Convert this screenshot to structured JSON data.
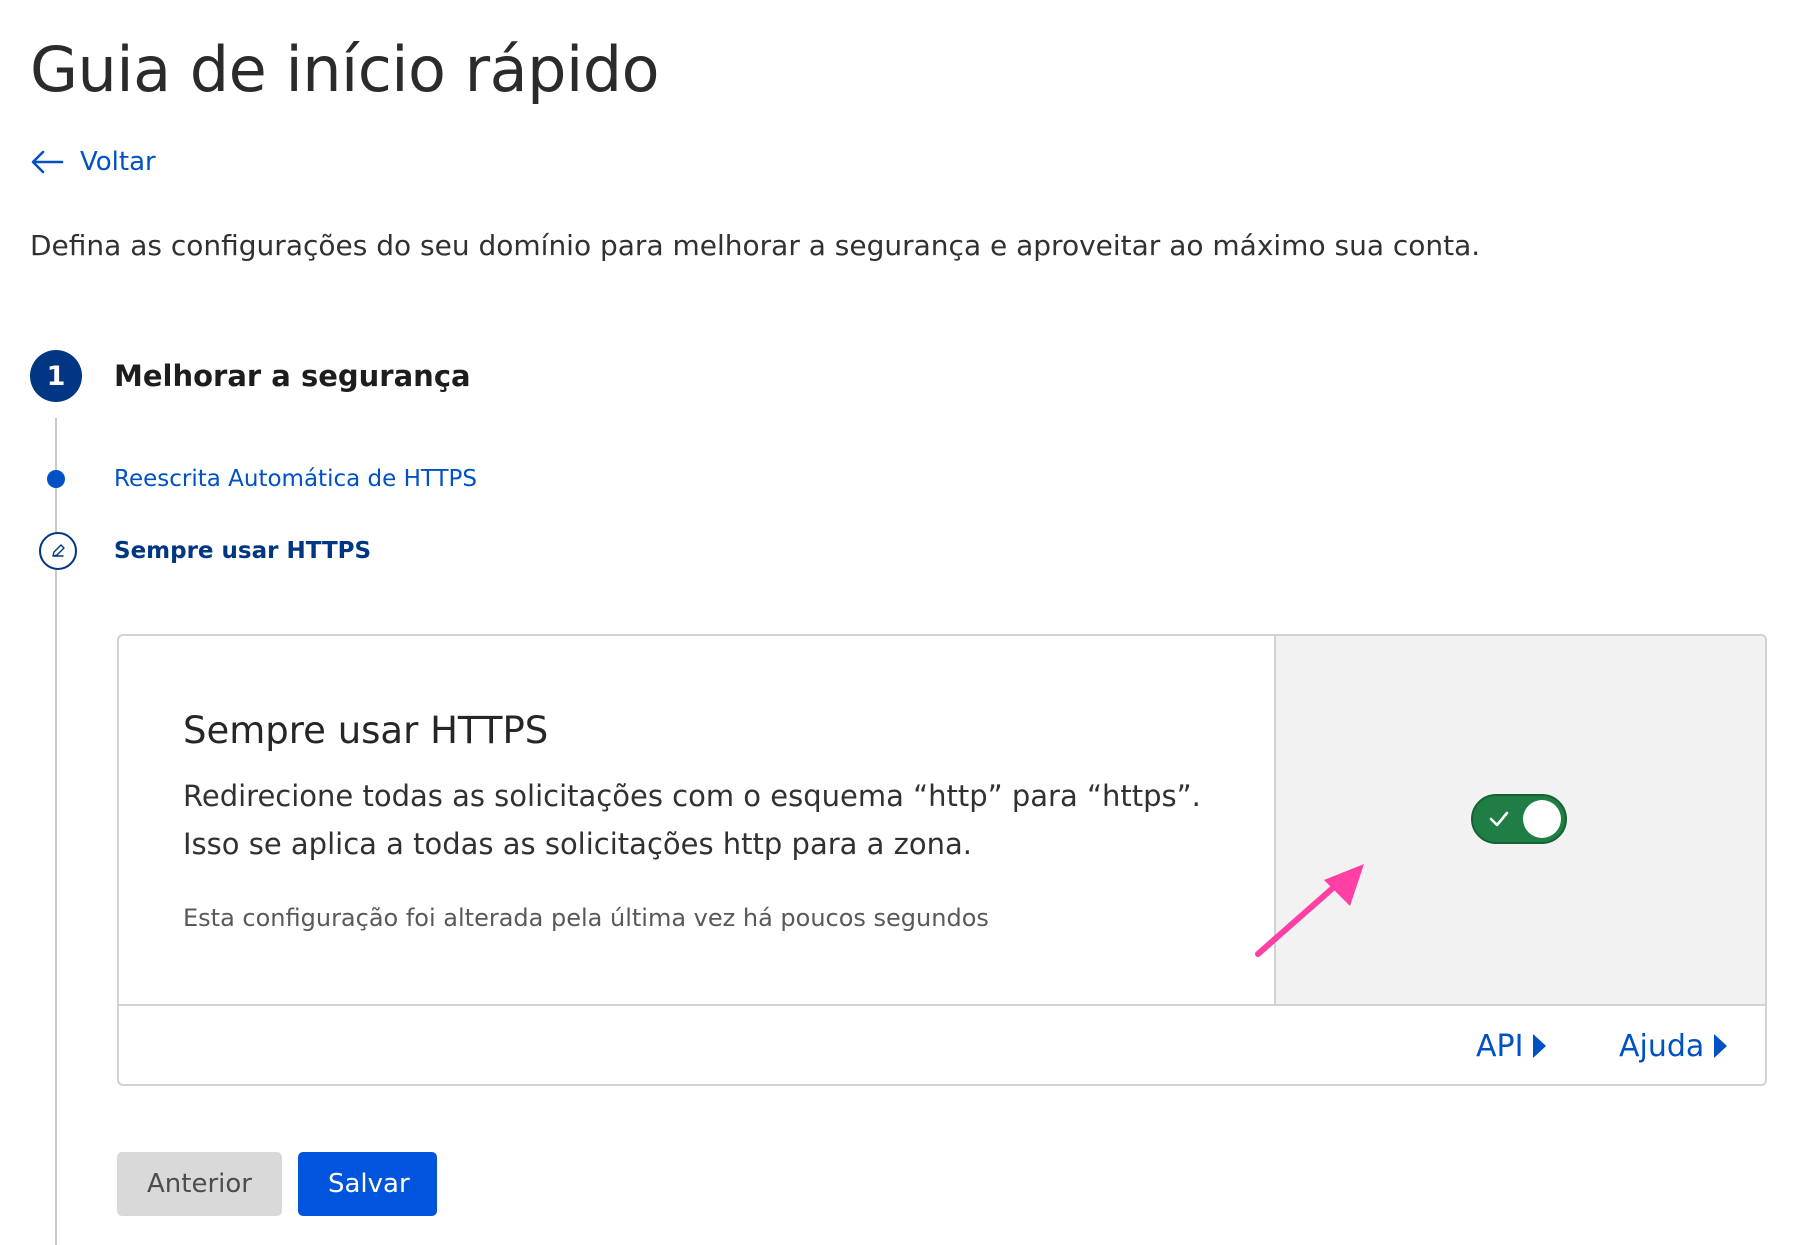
{
  "header": {
    "title": "Guia de início rápido",
    "back_label": "Voltar",
    "intro": "Defina as configurações do seu domínio para melhorar a segurança e aproveitar ao máximo sua conta."
  },
  "step": {
    "number": "1",
    "title": "Melhorar a segurança",
    "substeps": [
      {
        "label": "Reescrita Automática de HTTPS",
        "state": "completed"
      },
      {
        "label": "Sempre usar HTTPS",
        "state": "current"
      }
    ]
  },
  "setting_card": {
    "title": "Sempre usar HTTPS",
    "description_line1": "Redirecione todas as solicitações com o esquema “http” para “https”.",
    "description_line2": "Isso se aplica a todas as solicitações http para a zona.",
    "last_changed": "Esta configuração foi alterada pela última vez há poucos segundos",
    "toggle_on": true,
    "footer_links": {
      "api": "API",
      "help": "Ajuda"
    }
  },
  "actions": {
    "previous_label": "Anterior",
    "save_label": "Salvar"
  },
  "colors": {
    "link": "#0051c3",
    "step_active": "#003682",
    "toggle_on": "#1e7e43",
    "primary_button": "#0055dc",
    "annotation_arrow": "#ff3fa4"
  },
  "icons": {
    "back": "arrow-left-icon",
    "substep_done": "dot-icon",
    "substep_current": "pencil-icon",
    "toggle": "checkmark-icon",
    "footer": "caret-right-icon"
  }
}
